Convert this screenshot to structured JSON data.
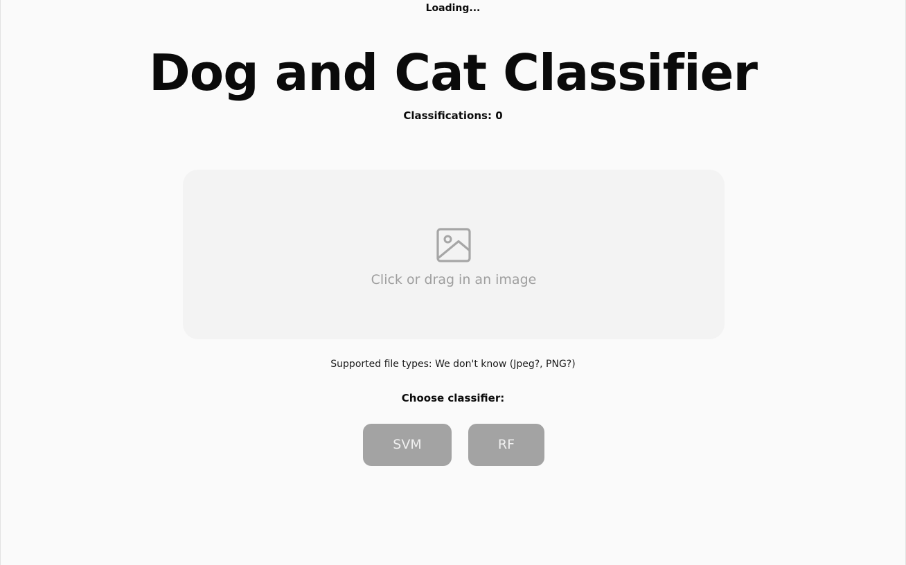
{
  "status": {
    "loading_text": "Loading..."
  },
  "header": {
    "title": "Dog and Cat Classifier",
    "classifications_text": "Classifications: 0"
  },
  "dropzone": {
    "icon": "image-icon",
    "label": "Click or drag in an image"
  },
  "supported_types_text": "Supported file types: We don't know (Jpeg?, PNG?)",
  "classifier": {
    "prompt": "Choose classifier:",
    "options": [
      "SVM",
      "RF"
    ]
  },
  "colors": {
    "background": "#fafafa",
    "dropzone_bg": "#f3f3f3",
    "muted_text": "#9e9e9e",
    "button_bg": "#a3a3a3"
  }
}
